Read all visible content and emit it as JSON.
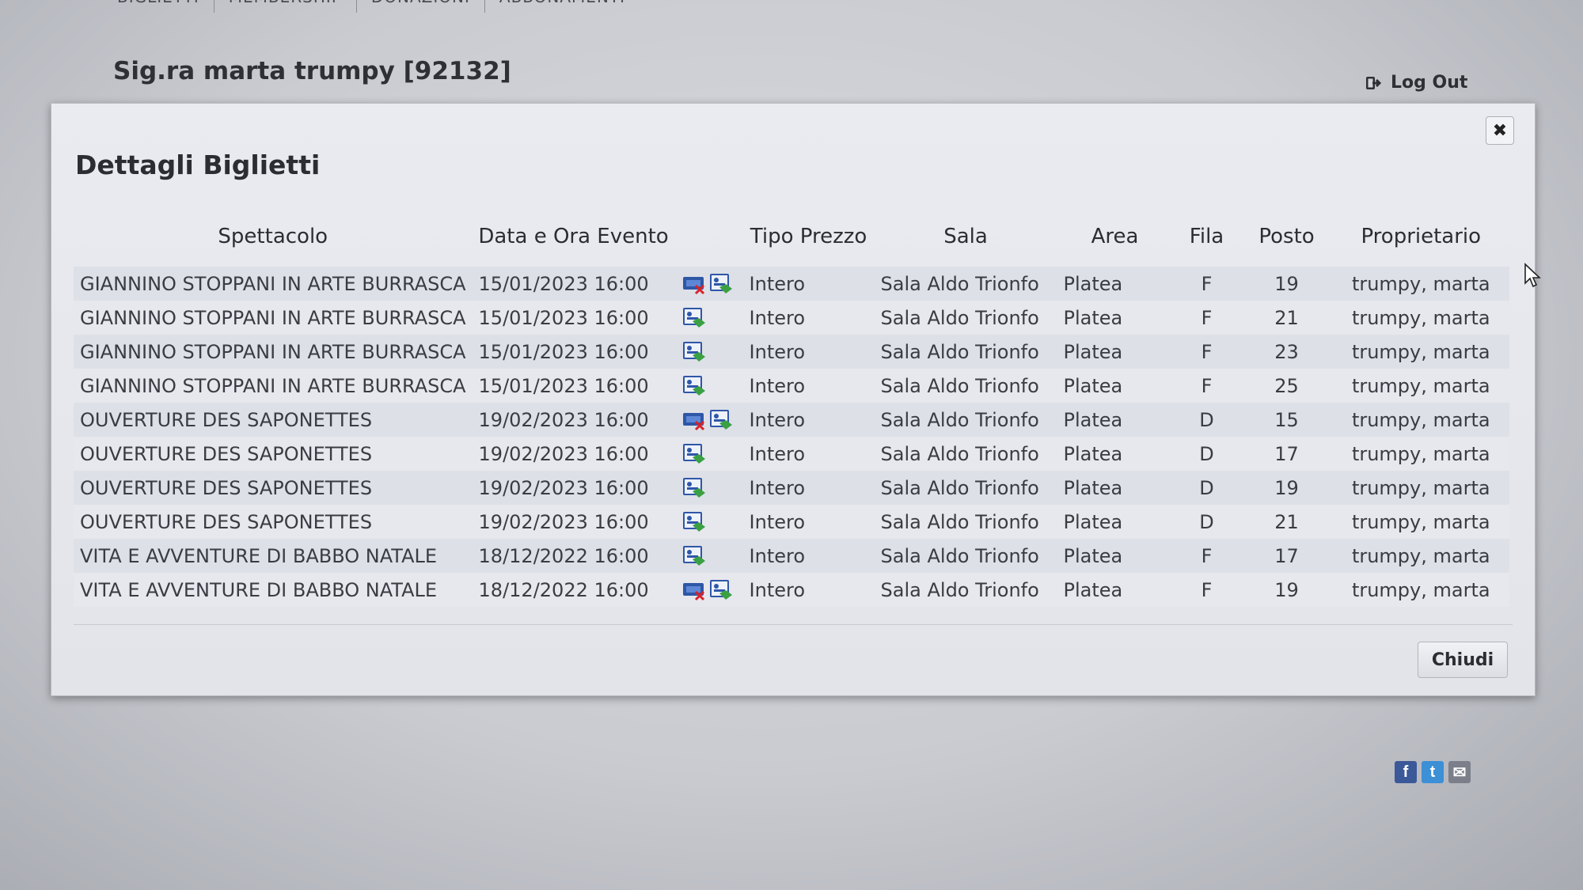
{
  "nav": {
    "tabs": [
      "BIGLIETTI",
      "MEMBERSHIP",
      "DONAZIONI",
      "ABBONAMENTI"
    ]
  },
  "header": {
    "user": "Sig.ra marta trumpy [92132]",
    "logout_label": "Log Out"
  },
  "modal": {
    "title": "Dettagli Biglietti",
    "close_label": "Chiudi",
    "columns": {
      "show": "Spettacolo",
      "datetime": "Data e Ora Evento",
      "price": "Tipo Prezzo",
      "sala": "Sala",
      "area": "Area",
      "fila": "Fila",
      "posto": "Posto",
      "owner": "Proprietario"
    },
    "rows": [
      {
        "show": "GIANNINO STOPPANI IN ARTE BURRASCA",
        "datetime": "15/01/2023 16:00",
        "icons": [
          "ticket-cancel-icon",
          "ticket-print-icon"
        ],
        "price": "Intero",
        "sala": "Sala Aldo Trionfo",
        "area": "Platea",
        "fila": "F",
        "posto": "19",
        "owner": "trumpy, marta"
      },
      {
        "show": "GIANNINO STOPPANI IN ARTE BURRASCA",
        "datetime": "15/01/2023 16:00",
        "icons": [
          "ticket-print-icon"
        ],
        "price": "Intero",
        "sala": "Sala Aldo Trionfo",
        "area": "Platea",
        "fila": "F",
        "posto": "21",
        "owner": "trumpy, marta"
      },
      {
        "show": "GIANNINO STOPPANI IN ARTE BURRASCA",
        "datetime": "15/01/2023 16:00",
        "icons": [
          "ticket-print-icon"
        ],
        "price": "Intero",
        "sala": "Sala Aldo Trionfo",
        "area": "Platea",
        "fila": "F",
        "posto": "23",
        "owner": "trumpy, marta"
      },
      {
        "show": "GIANNINO STOPPANI IN ARTE BURRASCA",
        "datetime": "15/01/2023 16:00",
        "icons": [
          "ticket-print-icon"
        ],
        "price": "Intero",
        "sala": "Sala Aldo Trionfo",
        "area": "Platea",
        "fila": "F",
        "posto": "25",
        "owner": "trumpy, marta"
      },
      {
        "show": "OUVERTURE DES SAPONETTES",
        "datetime": "19/02/2023 16:00",
        "icons": [
          "ticket-cancel-icon",
          "ticket-print-icon"
        ],
        "price": "Intero",
        "sala": "Sala Aldo Trionfo",
        "area": "Platea",
        "fila": "D",
        "posto": "15",
        "owner": "trumpy, marta"
      },
      {
        "show": "OUVERTURE DES SAPONETTES",
        "datetime": "19/02/2023 16:00",
        "icons": [
          "ticket-print-icon"
        ],
        "price": "Intero",
        "sala": "Sala Aldo Trionfo",
        "area": "Platea",
        "fila": "D",
        "posto": "17",
        "owner": "trumpy, marta"
      },
      {
        "show": "OUVERTURE DES SAPONETTES",
        "datetime": "19/02/2023 16:00",
        "icons": [
          "ticket-print-icon"
        ],
        "price": "Intero",
        "sala": "Sala Aldo Trionfo",
        "area": "Platea",
        "fila": "D",
        "posto": "19",
        "owner": "trumpy, marta"
      },
      {
        "show": "OUVERTURE DES SAPONETTES",
        "datetime": "19/02/2023 16:00",
        "icons": [
          "ticket-print-icon"
        ],
        "price": "Intero",
        "sala": "Sala Aldo Trionfo",
        "area": "Platea",
        "fila": "D",
        "posto": "21",
        "owner": "trumpy, marta"
      },
      {
        "show": "VITA E AVVENTURE DI BABBO NATALE",
        "datetime": "18/12/2022 16:00",
        "icons": [
          "ticket-print-icon"
        ],
        "price": "Intero",
        "sala": "Sala Aldo Trionfo",
        "area": "Platea",
        "fila": "F",
        "posto": "17",
        "owner": "trumpy, marta"
      },
      {
        "show": "VITA E AVVENTURE DI BABBO NATALE",
        "datetime": "18/12/2022 16:00",
        "icons": [
          "ticket-cancel-icon",
          "ticket-print-icon"
        ],
        "price": "Intero",
        "sala": "Sala Aldo Trionfo",
        "area": "Platea",
        "fila": "F",
        "posto": "19",
        "owner": "trumpy, marta"
      }
    ]
  },
  "social": [
    {
      "icon": "facebook-icon",
      "glyph": "f",
      "color": "#3b5998"
    },
    {
      "icon": "twitter-icon",
      "glyph": "t",
      "color": "#3d8fd6"
    },
    {
      "icon": "email-icon",
      "glyph": "✉",
      "color": "#7a7f8a"
    }
  ],
  "colors": {
    "modal_bg": "#e6e8ed",
    "row_alt": "#dde0e7",
    "text": "#3a3c44"
  }
}
